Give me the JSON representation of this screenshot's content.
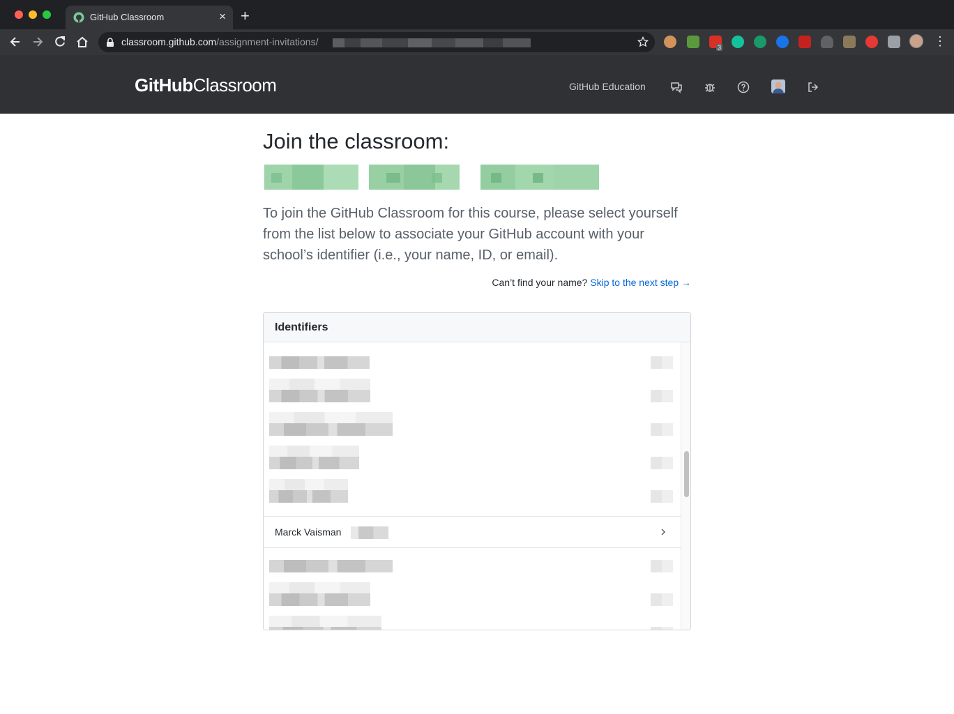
{
  "browser": {
    "tab_title": "GitHub Classroom",
    "url_host": "classroom.github.com",
    "url_path": "/assignment-invitations/",
    "extension_badge": "3"
  },
  "header": {
    "brand_bold": "GitHub",
    "brand_light": "Classroom",
    "education_link": "GitHub Education"
  },
  "main": {
    "title": "Join the classroom:",
    "intro": "To join the GitHub Classroom for this course, please select yourself from the list below to associate your GitHub account with your school’s identifier (i.e., your name, ID, or email).",
    "skip_prompt": "Can’t find your name?",
    "skip_link": "Skip to the next step →",
    "identifiers": {
      "heading": "Identifiers",
      "selected_name": "Marck Vaisman"
    }
  },
  "colors": {
    "header_bg": "#2f3134",
    "link": "#0366d6",
    "text": "#24292e",
    "muted": "#586069"
  }
}
